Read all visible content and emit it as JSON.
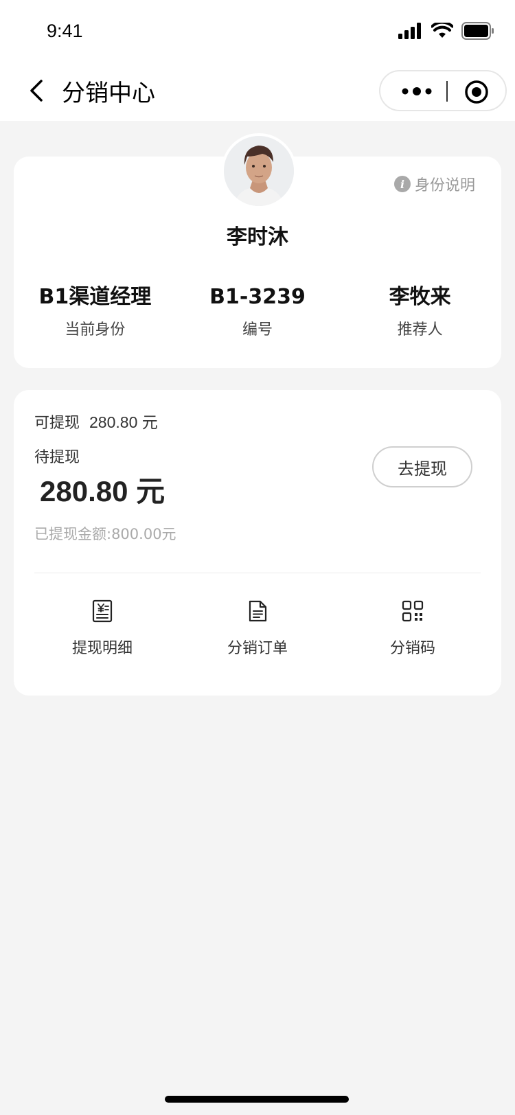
{
  "status_bar": {
    "time": "9:41"
  },
  "nav": {
    "title": "分销中心"
  },
  "profile": {
    "identity_link": "身份说明",
    "name": "李时沐",
    "stats": [
      {
        "value": "B1渠道经理",
        "label": "当前身份"
      },
      {
        "value": "B1-3239",
        "label": "编号"
      },
      {
        "value": "李牧来",
        "label": "推荐人"
      }
    ]
  },
  "wallet": {
    "available_label": "可提现",
    "available_amount": "280.80 元",
    "pending_label": "待提现",
    "pending_amount": "280.80 元",
    "withdraw_button": "去提现",
    "withdrawn_total": "已提现金额:800.00元"
  },
  "shortcuts": [
    {
      "label": "提现明细",
      "icon": "withdraw-detail-icon"
    },
    {
      "label": "分销订单",
      "icon": "document-icon"
    },
    {
      "label": "分销码",
      "icon": "qr-code-icon"
    }
  ],
  "colors": {
    "background": "#f4f4f4",
    "card": "#ffffff",
    "muted_text": "#999999"
  }
}
